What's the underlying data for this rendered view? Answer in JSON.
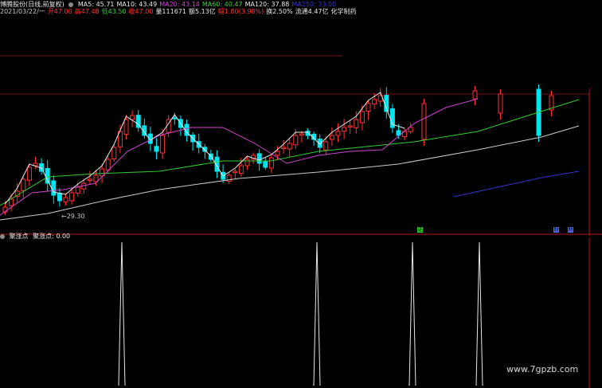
{
  "header": {
    "stock_title": "博腾股份(日线,前复权)",
    "ma_labels": [
      {
        "text": "MA5: 45.71",
        "color": "#e8e8e8"
      },
      {
        "text": "MA10: 43.49",
        "color": "#e8e8e8"
      },
      {
        "text": "MA20: 43.14",
        "color": "#cc44cc"
      },
      {
        "text": "MA60: 40.47",
        "color": "#33cc33"
      },
      {
        "text": "MA120: 37.88",
        "color": "#e8e8e8"
      },
      {
        "text": "MA250: 33.00",
        "color": "#3333cc"
      }
    ],
    "info_items": [
      {
        "text": "2021/03/22/一",
        "color": "#c8c8c8"
      },
      {
        "text": "开47.00",
        "color": "#ff3333"
      },
      {
        "text": "高47.48",
        "color": "#ff3333"
      },
      {
        "text": "低43.50",
        "color": "#33cc33"
      },
      {
        "text": "收47.00",
        "color": "#ff3333"
      },
      {
        "text": "量111671",
        "color": "#e8e8e8"
      },
      {
        "text": "额5.13亿",
        "color": "#e8e8e8"
      },
      {
        "text": "幅1.80(3.98%)",
        "color": "#ff3333"
      },
      {
        "text": "换2.50%",
        "color": "#e8e8e8"
      },
      {
        "text": "流通4.47亿",
        "color": "#e8e8e8"
      },
      {
        "text": "化学制药",
        "color": "#e8e8e8"
      }
    ]
  },
  "main_chart": {
    "low_label": "←29.30",
    "badges": [
      {
        "text": "送",
        "color": "#33cc33"
      },
      {
        "text": "财",
        "color": "#5566ff"
      },
      {
        "text": "财",
        "color": "#5566ff"
      }
    ]
  },
  "indicator": {
    "name": "聚涨点",
    "value_label": "聚涨点: 0.00",
    "spike_color": "#e8e8e8"
  },
  "watermark": "www.7gpzb.com",
  "colors": {
    "up": "#ff3333",
    "down": "#00e5ee",
    "ma5": "#e8e8e8",
    "ma20": "#cc44cc",
    "ma60": "#33cc33",
    "ma120": "#cccccc",
    "ma250": "#3333cc",
    "grid_red": "#7a1010"
  }
}
